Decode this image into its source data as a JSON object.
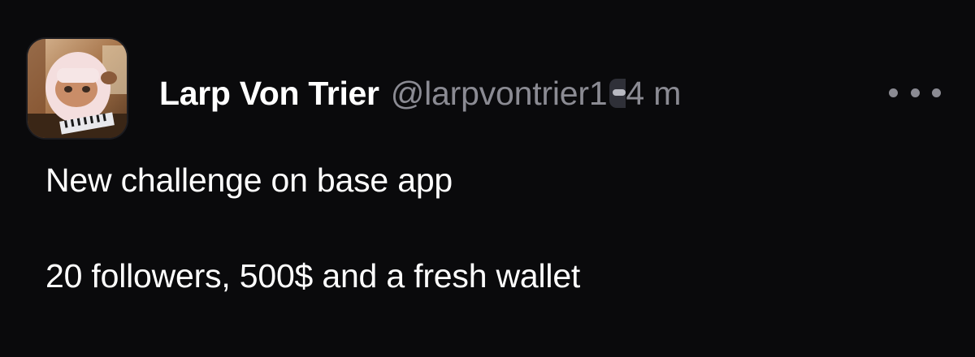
{
  "post": {
    "author": {
      "display_name": "Larp Von Trier",
      "handle": "@larpvontrier1",
      "avatar": "anime-character-avatar"
    },
    "timestamp": "4 m",
    "more_icon": "more-horizontal-icon",
    "body": {
      "line1": "New challenge on base app",
      "line2": "20 followers, 500$ and a fresh wallet"
    }
  },
  "colors": {
    "background": "#0a0a0c",
    "text": "#ffffff",
    "muted": "#8b8b93"
  }
}
